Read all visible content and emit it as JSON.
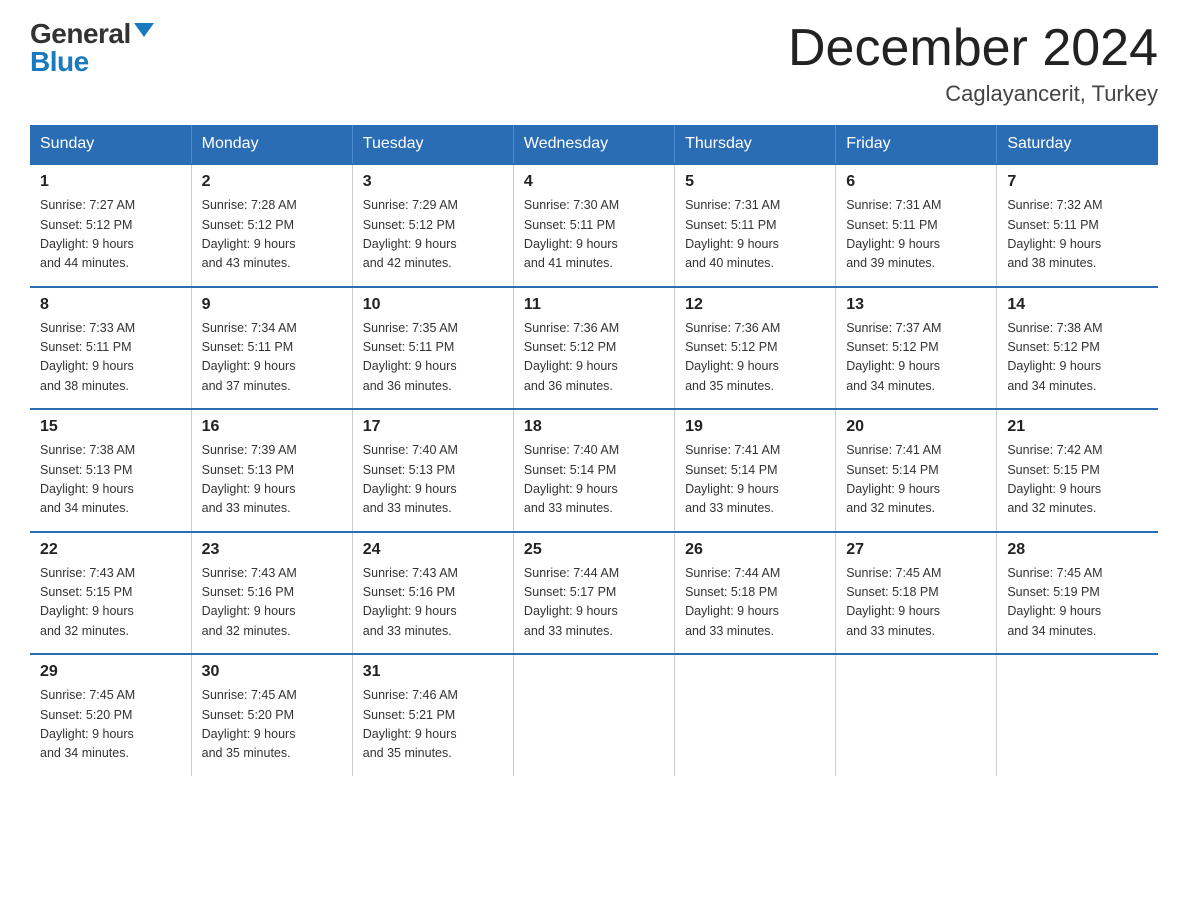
{
  "logo": {
    "general": "General",
    "blue": "Blue"
  },
  "title": {
    "month_year": "December 2024",
    "location": "Caglayancerit, Turkey"
  },
  "days_header": [
    "Sunday",
    "Monday",
    "Tuesday",
    "Wednesday",
    "Thursday",
    "Friday",
    "Saturday"
  ],
  "weeks": [
    [
      {
        "day": "1",
        "sunrise": "7:27 AM",
        "sunset": "5:12 PM",
        "daylight": "9 hours and 44 minutes."
      },
      {
        "day": "2",
        "sunrise": "7:28 AM",
        "sunset": "5:12 PM",
        "daylight": "9 hours and 43 minutes."
      },
      {
        "day": "3",
        "sunrise": "7:29 AM",
        "sunset": "5:12 PM",
        "daylight": "9 hours and 42 minutes."
      },
      {
        "day": "4",
        "sunrise": "7:30 AM",
        "sunset": "5:11 PM",
        "daylight": "9 hours and 41 minutes."
      },
      {
        "day": "5",
        "sunrise": "7:31 AM",
        "sunset": "5:11 PM",
        "daylight": "9 hours and 40 minutes."
      },
      {
        "day": "6",
        "sunrise": "7:31 AM",
        "sunset": "5:11 PM",
        "daylight": "9 hours and 39 minutes."
      },
      {
        "day": "7",
        "sunrise": "7:32 AM",
        "sunset": "5:11 PM",
        "daylight": "9 hours and 38 minutes."
      }
    ],
    [
      {
        "day": "8",
        "sunrise": "7:33 AM",
        "sunset": "5:11 PM",
        "daylight": "9 hours and 38 minutes."
      },
      {
        "day": "9",
        "sunrise": "7:34 AM",
        "sunset": "5:11 PM",
        "daylight": "9 hours and 37 minutes."
      },
      {
        "day": "10",
        "sunrise": "7:35 AM",
        "sunset": "5:11 PM",
        "daylight": "9 hours and 36 minutes."
      },
      {
        "day": "11",
        "sunrise": "7:36 AM",
        "sunset": "5:12 PM",
        "daylight": "9 hours and 36 minutes."
      },
      {
        "day": "12",
        "sunrise": "7:36 AM",
        "sunset": "5:12 PM",
        "daylight": "9 hours and 35 minutes."
      },
      {
        "day": "13",
        "sunrise": "7:37 AM",
        "sunset": "5:12 PM",
        "daylight": "9 hours and 34 minutes."
      },
      {
        "day": "14",
        "sunrise": "7:38 AM",
        "sunset": "5:12 PM",
        "daylight": "9 hours and 34 minutes."
      }
    ],
    [
      {
        "day": "15",
        "sunrise": "7:38 AM",
        "sunset": "5:13 PM",
        "daylight": "9 hours and 34 minutes."
      },
      {
        "day": "16",
        "sunrise": "7:39 AM",
        "sunset": "5:13 PM",
        "daylight": "9 hours and 33 minutes."
      },
      {
        "day": "17",
        "sunrise": "7:40 AM",
        "sunset": "5:13 PM",
        "daylight": "9 hours and 33 minutes."
      },
      {
        "day": "18",
        "sunrise": "7:40 AM",
        "sunset": "5:14 PM",
        "daylight": "9 hours and 33 minutes."
      },
      {
        "day": "19",
        "sunrise": "7:41 AM",
        "sunset": "5:14 PM",
        "daylight": "9 hours and 33 minutes."
      },
      {
        "day": "20",
        "sunrise": "7:41 AM",
        "sunset": "5:14 PM",
        "daylight": "9 hours and 32 minutes."
      },
      {
        "day": "21",
        "sunrise": "7:42 AM",
        "sunset": "5:15 PM",
        "daylight": "9 hours and 32 minutes."
      }
    ],
    [
      {
        "day": "22",
        "sunrise": "7:43 AM",
        "sunset": "5:15 PM",
        "daylight": "9 hours and 32 minutes."
      },
      {
        "day": "23",
        "sunrise": "7:43 AM",
        "sunset": "5:16 PM",
        "daylight": "9 hours and 32 minutes."
      },
      {
        "day": "24",
        "sunrise": "7:43 AM",
        "sunset": "5:16 PM",
        "daylight": "9 hours and 33 minutes."
      },
      {
        "day": "25",
        "sunrise": "7:44 AM",
        "sunset": "5:17 PM",
        "daylight": "9 hours and 33 minutes."
      },
      {
        "day": "26",
        "sunrise": "7:44 AM",
        "sunset": "5:18 PM",
        "daylight": "9 hours and 33 minutes."
      },
      {
        "day": "27",
        "sunrise": "7:45 AM",
        "sunset": "5:18 PM",
        "daylight": "9 hours and 33 minutes."
      },
      {
        "day": "28",
        "sunrise": "7:45 AM",
        "sunset": "5:19 PM",
        "daylight": "9 hours and 34 minutes."
      }
    ],
    [
      {
        "day": "29",
        "sunrise": "7:45 AM",
        "sunset": "5:20 PM",
        "daylight": "9 hours and 34 minutes."
      },
      {
        "day": "30",
        "sunrise": "7:45 AM",
        "sunset": "5:20 PM",
        "daylight": "9 hours and 35 minutes."
      },
      {
        "day": "31",
        "sunrise": "7:46 AM",
        "sunset": "5:21 PM",
        "daylight": "9 hours and 35 minutes."
      },
      null,
      null,
      null,
      null
    ]
  ],
  "labels": {
    "sunrise": "Sunrise:",
    "sunset": "Sunset:",
    "daylight": "Daylight: 9 hours"
  }
}
